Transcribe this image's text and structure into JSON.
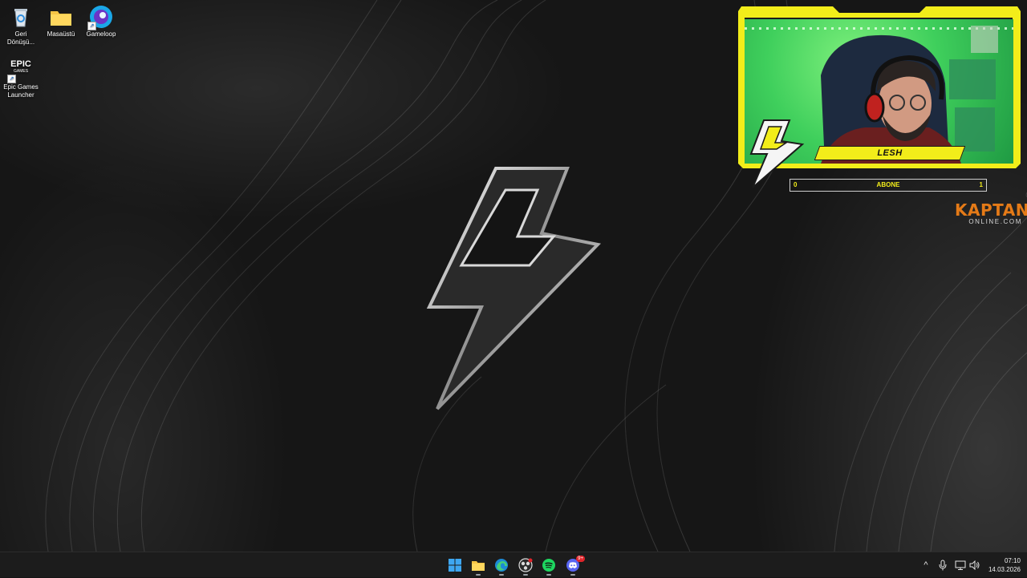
{
  "desktop": {
    "icons": [
      {
        "name": "recycle-bin",
        "label": "Geri\nDönüşü..."
      },
      {
        "name": "folder-masaustu",
        "label": "Masaüstü"
      },
      {
        "name": "gameloop",
        "label": "Gameloop"
      },
      {
        "name": "epic-games-launcher",
        "label": "Epic Games\nLauncher",
        "glyph_text": "EPIC",
        "glyph_sub": "GAMES"
      }
    ]
  },
  "overlay": {
    "streamer_name": "LESH",
    "sub_goal": {
      "label": "ABONE",
      "current": "0",
      "goal": "1",
      "progress": 0
    },
    "brand": {
      "line1": "KAPTAN",
      "line2": "ONLINE.COM"
    },
    "colors": {
      "accent": "#f2ed1a",
      "brand": "#e47a17",
      "greenscreen": "#3fcf5c"
    }
  },
  "taskbar": {
    "apps": [
      {
        "name": "start-button",
        "icon": "windows-icon"
      },
      {
        "name": "file-explorer-button",
        "icon": "folder-icon"
      },
      {
        "name": "edge-button",
        "icon": "edge-icon"
      },
      {
        "name": "obs-button",
        "icon": "obs-icon"
      },
      {
        "name": "spotify-button",
        "icon": "spotify-icon"
      },
      {
        "name": "discord-button",
        "icon": "discord-icon",
        "badge": "9+"
      }
    ],
    "tray": {
      "chevron": "^",
      "time": "07:10",
      "date": "14.03.2026"
    }
  }
}
